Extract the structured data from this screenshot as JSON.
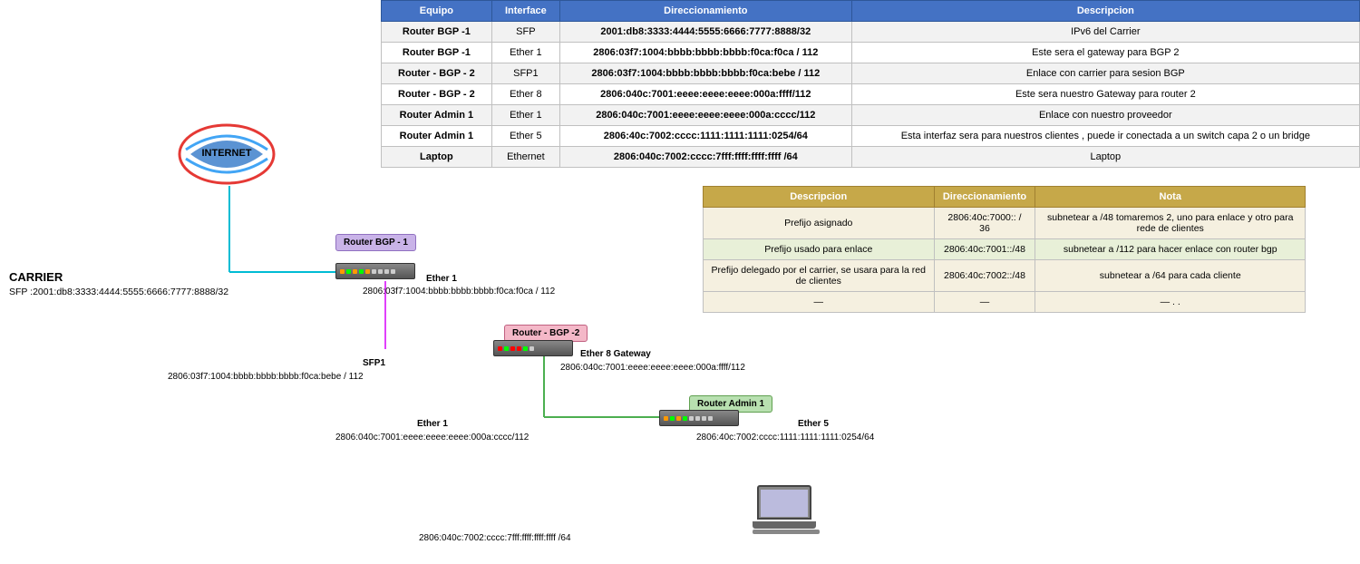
{
  "table1": {
    "headers": [
      "Equipo",
      "Interface",
      "Direccionamiento",
      "Descripcion"
    ],
    "rows": [
      {
        "equipo": "Router BGP -1",
        "interface": "SFP",
        "direccionamiento": "2001:db8:3333:4444:5555:6666:7777:8888/32",
        "descripcion": "IPv6 del Carrier"
      },
      {
        "equipo": "Router BGP -1",
        "interface": "Ether 1",
        "direccionamiento": "2806:03f7:1004:bbbb:bbbb:bbbb:f0ca:f0ca / 112",
        "descripcion": "Este sera el gateway para BGP 2"
      },
      {
        "equipo": "Router - BGP - 2",
        "interface": "SFP1",
        "direccionamiento": "2806:03f7:1004:bbbb:bbbb:bbbb:f0ca:bebe / 112",
        "descripcion": "Enlace con carrier para sesion BGP"
      },
      {
        "equipo": "Router - BGP - 2",
        "interface": "Ether 8",
        "direccionamiento": "2806:040c:7001:eeee:eeee:eeee:000a:ffff/112",
        "descripcion": "Este sera nuestro Gateway para router 2"
      },
      {
        "equipo": "Router Admin 1",
        "interface": "Ether 1",
        "direccionamiento": "2806:040c:7001:eeee:eeee:eeee:000a:cccc/112",
        "descripcion": "Enlace con nuestro proveedor"
      },
      {
        "equipo": "Router Admin 1",
        "interface": "Ether 5",
        "direccionamiento": "2806:40c:7002:cccc:1111:1111:1111:0254/64",
        "descripcion": "Esta interfaz sera para nuestros clientes , puede ir conectada a un switch capa 2 o un bridge"
      },
      {
        "equipo": "Laptop",
        "interface": "Ethernet",
        "direccionamiento": "2806:040c:7002:cccc:7fff:ffff:ffff:ffff /64",
        "descripcion": "Laptop"
      }
    ]
  },
  "table2": {
    "headers": [
      "Descripcion",
      "Direccionamiento",
      "Nota"
    ],
    "rows": [
      {
        "descripcion": "Prefijo asignado",
        "direccionamiento": "2806:40c:7000:: / 36",
        "nota": "subnetear a /48  tomaremos 2, uno para enlace y otro para rede de clientes"
      },
      {
        "descripcion": "Prefijo usado para enlace",
        "direccionamiento": "2806:40c:7001::/48",
        "nota": "subnetear a /112 para hacer enlace con router bgp"
      },
      {
        "descripcion": "Prefijo delegado por el carrier, se usara para la red de clientes",
        "direccionamiento": "2806:40c:7002::/48",
        "nota": "subnetear a /64 para cada cliente"
      },
      {
        "descripcion": "—",
        "direccionamiento": "—",
        "nota": "— . ."
      }
    ]
  },
  "diagram": {
    "internet_label": "INTERNET",
    "carrier_label": "CARRIER",
    "carrier_sfp": "SFP :2001:db8:3333:4444:5555:6666:7777:8888/32",
    "router_bgp1_label": "Router BGP -\n1",
    "router_bgp2_label": "Router - BGP -2",
    "router_admin1_label": "Router Admin 1",
    "ether1_label1": "Ether 1",
    "ether1_addr1": "2806:03f7:1004:bbbb:bbbb:bbbb:f0ca:f0ca / 112",
    "sfp1_label": "SFP1",
    "sfp1_addr": "2806:03f7:1004:bbbb:bbbb:bbbb:f0ca:bebe / 112",
    "ether8_label": "Ether 8 Gateway",
    "ether8_addr": "2806:040c:7001:eeee:eeee:eeee:000a:ffff/112",
    "ether1_label2": "Ether 1",
    "ether1_addr2": "2806:040c:7001:eeee:eeee:eeee:000a:cccc/112",
    "ether5_label": "Ether 5",
    "ether5_addr": "2806:40c:7002:cccc:1111:1111:1111:0254/64",
    "laptop_addr": "2806:040c:7002:cccc:7fff:ffff:ffff:ffff /64"
  }
}
